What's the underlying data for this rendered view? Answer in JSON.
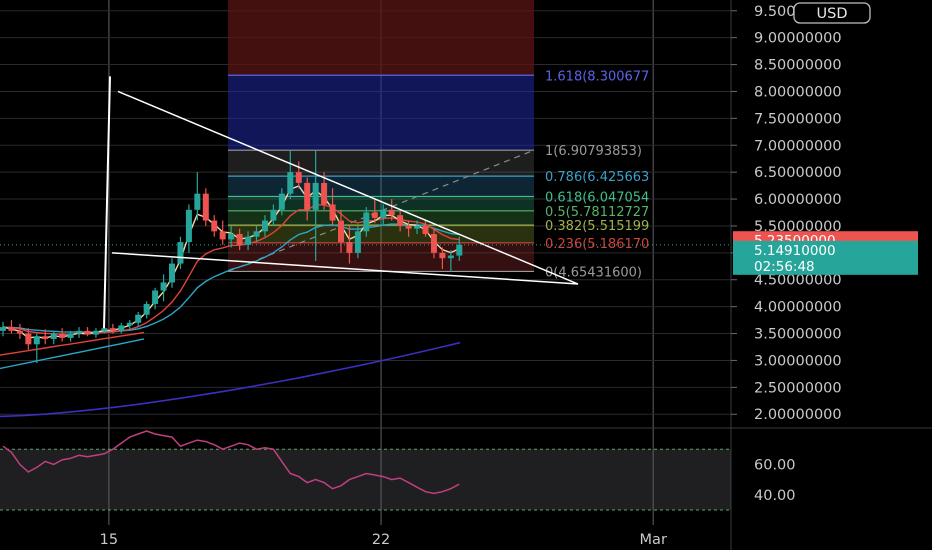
{
  "currency_button": "USD",
  "colors": {
    "background": "#000000",
    "grid": "#2a2a2e",
    "candle_up": "#26a69a",
    "candle_down": "#ef5350",
    "ema_fast": "#f5d9a8",
    "ema_mid": "#e0433b",
    "ema_slow": "#2aa7c9",
    "ema_long": "#3b2fc0",
    "rsi_line": "#c0407f",
    "trendline": "#ffffff"
  },
  "chart_data": {
    "type": "candlestick",
    "y_axis": {
      "ticks": [
        "9.50000000",
        "9.00000000",
        "8.50000000",
        "8.00000000",
        "7.50000000",
        "7.00000000",
        "6.50000000",
        "6.00000000",
        "5.50000000",
        "5.00000000",
        "4.50000000",
        "4.00000000",
        "3.50000000",
        "3.00000000",
        "2.50000000",
        "2.00000000"
      ],
      "tick_values": [
        9.5,
        9.0,
        8.5,
        8.0,
        7.5,
        7.0,
        6.5,
        6.0,
        5.5,
        5.0,
        4.5,
        4.0,
        3.5,
        3.0,
        2.5,
        2.0
      ],
      "range": [
        1.8,
        9.7
      ]
    },
    "x_axis": {
      "ticks": [
        "15",
        "22",
        "Mar"
      ],
      "range_days": [
        12.2,
        31.0
      ]
    },
    "price_badges": [
      {
        "label": "5.23500000",
        "value": 5.235,
        "color": "#ef5350"
      },
      {
        "label": "5.14910000",
        "value": 5.1491,
        "color": "#26a69a",
        "sub": "02:56:48"
      }
    ],
    "fib_levels": [
      {
        "ratio": "1.618",
        "label": "1.618(8.300677",
        "value": 8.300677,
        "color": "#5a63e8"
      },
      {
        "ratio": "1",
        "label": "1(6.90793853)",
        "value": 6.90793853,
        "color": "#9a9a9a"
      },
      {
        "ratio": "0.786",
        "label": "0.786(6.425663",
        "value": 6.425663,
        "color": "#3aa0c8"
      },
      {
        "ratio": "0.618",
        "label": "0.618(6.047054",
        "value": 6.047054,
        "color": "#3fbf8a"
      },
      {
        "ratio": "0.5",
        "label": "0.5(5.78112727",
        "value": 5.78112727,
        "color": "#55b36a"
      },
      {
        "ratio": "0.382",
        "label": "0.382(5.515199",
        "value": 5.515199,
        "color": "#9fb34a"
      },
      {
        "ratio": "0.236",
        "label": "0.236(5.186170",
        "value": 5.18617,
        "color": "#d0443c"
      },
      {
        "ratio": "0",
        "label": "0(4.65431600)",
        "value": 4.654316,
        "color": "#9a9a9a"
      }
    ],
    "candles": [
      {
        "o": 3.55,
        "h": 3.72,
        "l": 3.45,
        "c": 3.62
      },
      {
        "o": 3.62,
        "h": 3.75,
        "l": 3.5,
        "c": 3.55
      },
      {
        "o": 3.55,
        "h": 3.68,
        "l": 3.4,
        "c": 3.5
      },
      {
        "o": 3.5,
        "h": 3.6,
        "l": 3.2,
        "c": 3.3
      },
      {
        "o": 3.3,
        "h": 3.5,
        "l": 2.95,
        "c": 3.45
      },
      {
        "o": 3.45,
        "h": 3.58,
        "l": 3.3,
        "c": 3.4
      },
      {
        "o": 3.4,
        "h": 3.55,
        "l": 3.3,
        "c": 3.5
      },
      {
        "o": 3.5,
        "h": 3.6,
        "l": 3.35,
        "c": 3.42
      },
      {
        "o": 3.42,
        "h": 3.55,
        "l": 3.35,
        "c": 3.5
      },
      {
        "o": 3.5,
        "h": 3.62,
        "l": 3.42,
        "c": 3.55
      },
      {
        "o": 3.55,
        "h": 3.62,
        "l": 3.45,
        "c": 3.48
      },
      {
        "o": 3.48,
        "h": 3.6,
        "l": 3.42,
        "c": 3.55
      },
      {
        "o": 3.55,
        "h": 3.65,
        "l": 3.5,
        "c": 3.6
      },
      {
        "o": 3.6,
        "h": 3.68,
        "l": 3.5,
        "c": 3.55
      },
      {
        "o": 3.55,
        "h": 3.7,
        "l": 3.5,
        "c": 3.65
      },
      {
        "o": 3.65,
        "h": 3.75,
        "l": 3.55,
        "c": 3.7
      },
      {
        "o": 3.7,
        "h": 3.9,
        "l": 3.62,
        "c": 3.85
      },
      {
        "o": 3.85,
        "h": 4.1,
        "l": 3.78,
        "c": 4.05
      },
      {
        "o": 4.05,
        "h": 4.35,
        "l": 3.95,
        "c": 4.3
      },
      {
        "o": 4.3,
        "h": 4.6,
        "l": 4.1,
        "c": 4.45
      },
      {
        "o": 4.45,
        "h": 4.9,
        "l": 4.35,
        "c": 4.8
      },
      {
        "o": 4.8,
        "h": 5.3,
        "l": 4.7,
        "c": 5.2
      },
      {
        "o": 5.2,
        "h": 5.9,
        "l": 5.0,
        "c": 5.8
      },
      {
        "o": 5.8,
        "h": 6.5,
        "l": 5.6,
        "c": 6.1
      },
      {
        "o": 6.1,
        "h": 6.2,
        "l": 5.5,
        "c": 5.6
      },
      {
        "o": 5.6,
        "h": 5.7,
        "l": 5.3,
        "c": 5.4
      },
      {
        "o": 5.4,
        "h": 5.6,
        "l": 5.15,
        "c": 5.25
      },
      {
        "o": 5.25,
        "h": 5.5,
        "l": 5.1,
        "c": 5.35
      },
      {
        "o": 5.35,
        "h": 5.45,
        "l": 5.05,
        "c": 5.15
      },
      {
        "o": 5.15,
        "h": 5.4,
        "l": 5.05,
        "c": 5.3
      },
      {
        "o": 5.3,
        "h": 5.5,
        "l": 5.2,
        "c": 5.4
      },
      {
        "o": 5.4,
        "h": 5.7,
        "l": 5.3,
        "c": 5.6
      },
      {
        "o": 5.6,
        "h": 5.9,
        "l": 5.5,
        "c": 5.8
      },
      {
        "o": 5.8,
        "h": 6.2,
        "l": 5.7,
        "c": 6.1
      },
      {
        "o": 6.1,
        "h": 6.9,
        "l": 6.0,
        "c": 6.5
      },
      {
        "o": 6.5,
        "h": 6.7,
        "l": 6.2,
        "c": 6.3
      },
      {
        "o": 6.3,
        "h": 6.4,
        "l": 5.6,
        "c": 5.8
      },
      {
        "o": 5.8,
        "h": 6.9,
        "l": 4.85,
        "c": 6.3
      },
      {
        "o": 6.3,
        "h": 6.5,
        "l": 5.8,
        "c": 5.9
      },
      {
        "o": 5.9,
        "h": 6.2,
        "l": 5.5,
        "c": 5.6
      },
      {
        "o": 5.6,
        "h": 5.8,
        "l": 5.0,
        "c": 5.2
      },
      {
        "o": 5.2,
        "h": 5.5,
        "l": 4.8,
        "c": 5.0
      },
      {
        "o": 5.0,
        "h": 5.5,
        "l": 4.9,
        "c": 5.4
      },
      {
        "o": 5.4,
        "h": 5.85,
        "l": 5.3,
        "c": 5.75
      },
      {
        "o": 5.75,
        "h": 6.0,
        "l": 5.55,
        "c": 5.65
      },
      {
        "o": 5.65,
        "h": 5.9,
        "l": 5.5,
        "c": 5.8
      },
      {
        "o": 5.8,
        "h": 6.0,
        "l": 5.6,
        "c": 5.7
      },
      {
        "o": 5.7,
        "h": 5.8,
        "l": 5.4,
        "c": 5.5
      },
      {
        "o": 5.5,
        "h": 5.6,
        "l": 5.3,
        "c": 5.45
      },
      {
        "o": 5.45,
        "h": 5.6,
        "l": 5.35,
        "c": 5.5
      },
      {
        "o": 5.5,
        "h": 5.6,
        "l": 5.3,
        "c": 5.35
      },
      {
        "o": 5.35,
        "h": 5.45,
        "l": 4.9,
        "c": 5.0
      },
      {
        "o": 5.0,
        "h": 5.1,
        "l": 4.7,
        "c": 4.9
      },
      {
        "o": 4.9,
        "h": 5.05,
        "l": 4.65,
        "c": 4.95
      },
      {
        "o": 4.95,
        "h": 5.3,
        "l": 4.85,
        "c": 5.15
      }
    ],
    "indicators": {
      "rsi_axis": {
        "ticks": [
          "60.00",
          "40.00"
        ],
        "tick_values": [
          60,
          40
        ],
        "range": [
          28,
          82
        ]
      },
      "rsi_values": [
        72,
        68,
        60,
        55,
        58,
        62,
        60,
        63,
        64,
        66,
        65,
        66,
        67,
        70,
        74,
        78,
        80,
        82,
        80,
        79,
        78,
        72,
        74,
        76,
        75,
        73,
        70,
        72,
        74,
        73,
        70,
        71,
        70,
        62,
        54,
        52,
        48,
        50,
        48,
        44,
        46,
        50,
        52,
        54,
        53,
        52,
        50,
        51,
        48,
        45,
        42,
        41,
        42,
        44,
        47
      ]
    }
  }
}
